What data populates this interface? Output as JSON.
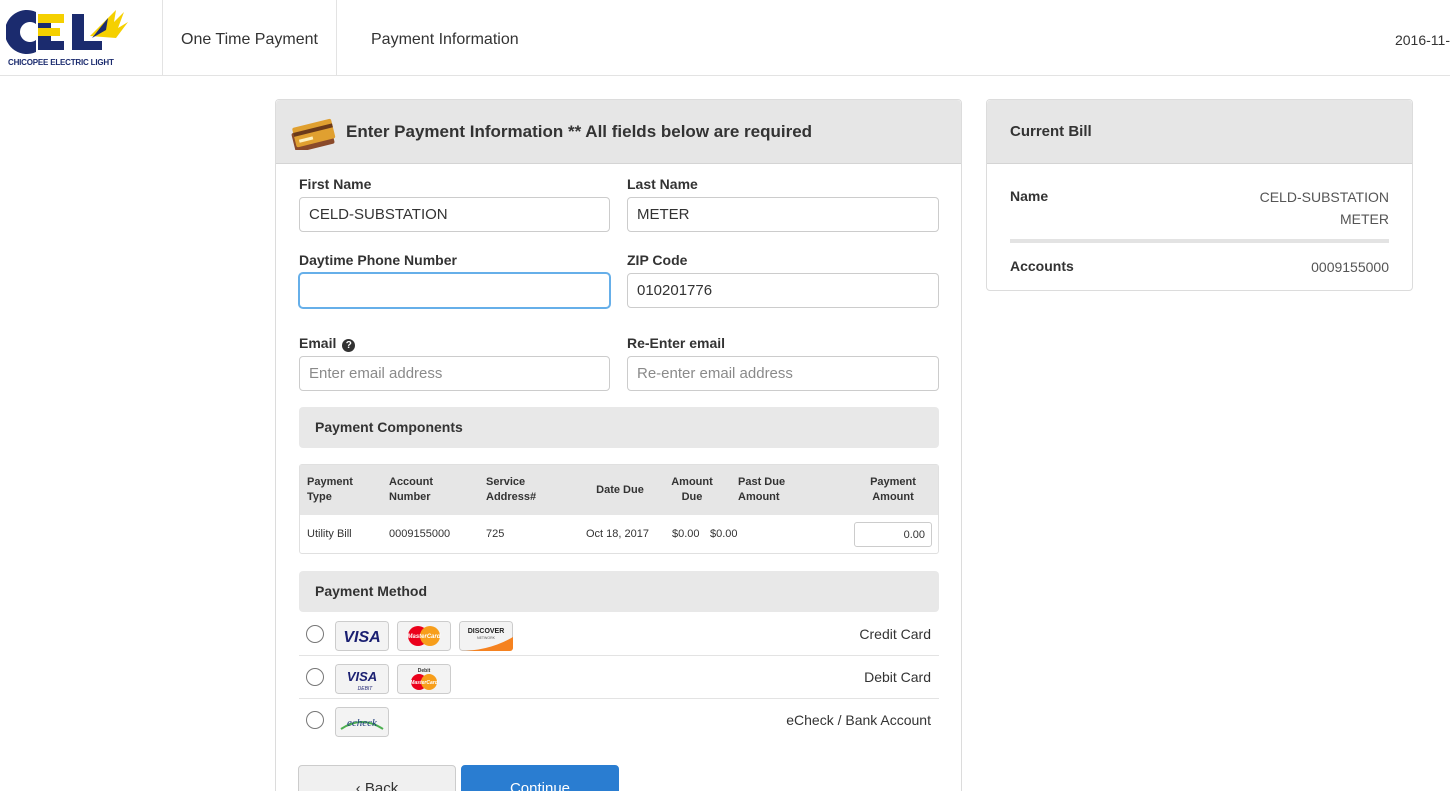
{
  "brand": {
    "logo_text": "CHICOPEE ELECTRIC LIGHT"
  },
  "nav": {
    "item1": "One Time Payment",
    "item2": "Payment Information"
  },
  "header": {
    "date": "2016-11-"
  },
  "payment_panel": {
    "title": "Enter Payment Information ** All fields below are required",
    "fields": {
      "first_name": {
        "label": "First Name",
        "value": "CELD-SUBSTATION"
      },
      "last_name": {
        "label": "Last Name",
        "value": "METER"
      },
      "phone": {
        "label": "Daytime Phone Number",
        "value": ""
      },
      "zip": {
        "label": "ZIP Code",
        "value": "010201776"
      },
      "email": {
        "label": "Email",
        "placeholder": "Enter email address"
      },
      "email_confirm": {
        "label": "Re-Enter email",
        "placeholder": "Re-enter email address"
      }
    },
    "components": {
      "title": "Payment Components",
      "columns": {
        "type_1": "Payment",
        "type_2": "Type",
        "acct_1": "Account",
        "acct_2": "Number",
        "svc_1": "Service",
        "svc_2": "Address#",
        "due_date": "Date Due",
        "amt_1": "Amount",
        "amt_2": "Due",
        "past_1": "Past Due",
        "past_2": "Amount",
        "pay_1": "Payment",
        "pay_2": "Amount"
      },
      "row": {
        "type": "Utility Bill",
        "account": "0009155000",
        "service": "725",
        "due_date": "Oct 18, 2017",
        "amount_due": "$0.00",
        "past_due": "$0.00",
        "payment_amount": "0.00"
      }
    },
    "method": {
      "title": "Payment Method",
      "credit_label": "Credit Card",
      "debit_label": "Debit Card",
      "echeck_label": "eCheck / Bank Account",
      "logos": {
        "visa": "VISA",
        "mastercard": "MasterCard",
        "discover": "DISCOVER",
        "discover_sub": "NETWORK",
        "visa_debit": "VISA",
        "visa_debit_sub": "DEBIT",
        "mc_debit_top": "Debit",
        "mc_debit": "MasterCard",
        "echeck": "echeck"
      }
    },
    "buttons": {
      "back": "‹ Back",
      "continue": "Continue"
    }
  },
  "current_bill": {
    "title": "Current Bill",
    "name_label": "Name",
    "name_line1": "CELD-SUBSTATION",
    "name_line2": "METER",
    "accounts_label": "Accounts",
    "accounts_value": "0009155000"
  },
  "colors": {
    "brand_blue": "#1b2b6e",
    "brand_yellow": "#f5d000",
    "primary_button": "#2a7dd1",
    "panel_header": "#e6e6e6"
  }
}
